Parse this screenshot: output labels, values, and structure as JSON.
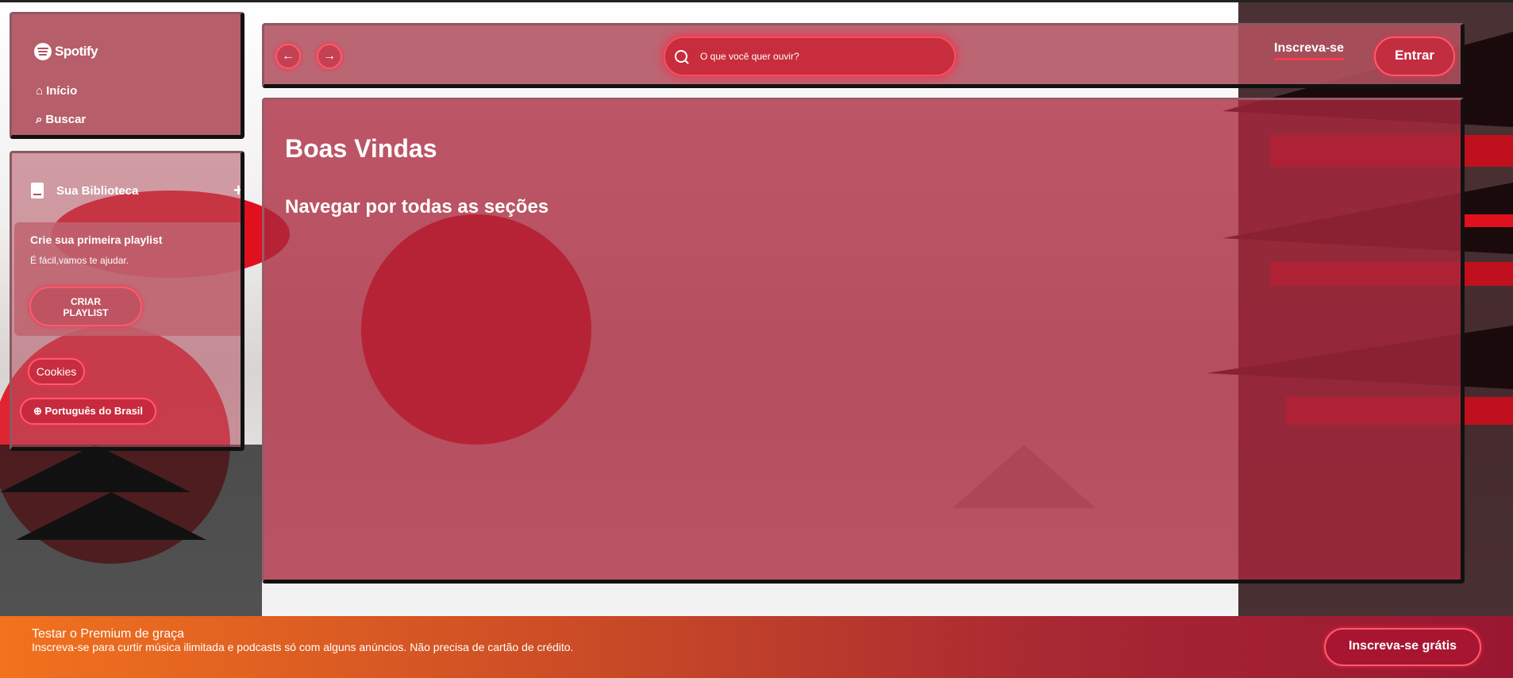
{
  "sidebar": {
    "logo_text": "Spotify",
    "nav": [
      {
        "label": "Início",
        "icon": "home-icon"
      },
      {
        "label": "Buscar",
        "icon": "search-icon"
      }
    ],
    "library": {
      "title": "Sua Biblioteca",
      "add_label": "+",
      "playlist_card": {
        "title": "Crie sua primeira playlist",
        "subtitle": "É fácil,vamos te ajudar.",
        "button": "CRIAR PLAYLIST"
      },
      "cookies_button": "Cookies",
      "language_button": "Português do Brasil"
    }
  },
  "header": {
    "back_icon": "arrow-left-icon",
    "forward_icon": "arrow-right-icon",
    "search_placeholder": "O que você quer ouvir?",
    "signup_label": "Inscreva-se",
    "login_label": "Entrar"
  },
  "main": {
    "title": "Boas Vindas",
    "section_title": "Navegar por todas as seções"
  },
  "footer": {
    "title": "Testar o Premium de graça",
    "subtitle": "Inscreva-se para curtir música ilimitada e podcasts só com alguns anúncios. Não precisa de cartão de crédito.",
    "button": "Inscreva-se grátis"
  },
  "colors": {
    "accent": "#ff3a4e",
    "panel": "#b25260",
    "footer_start": "#f2721e",
    "footer_end": "#9a1632"
  }
}
